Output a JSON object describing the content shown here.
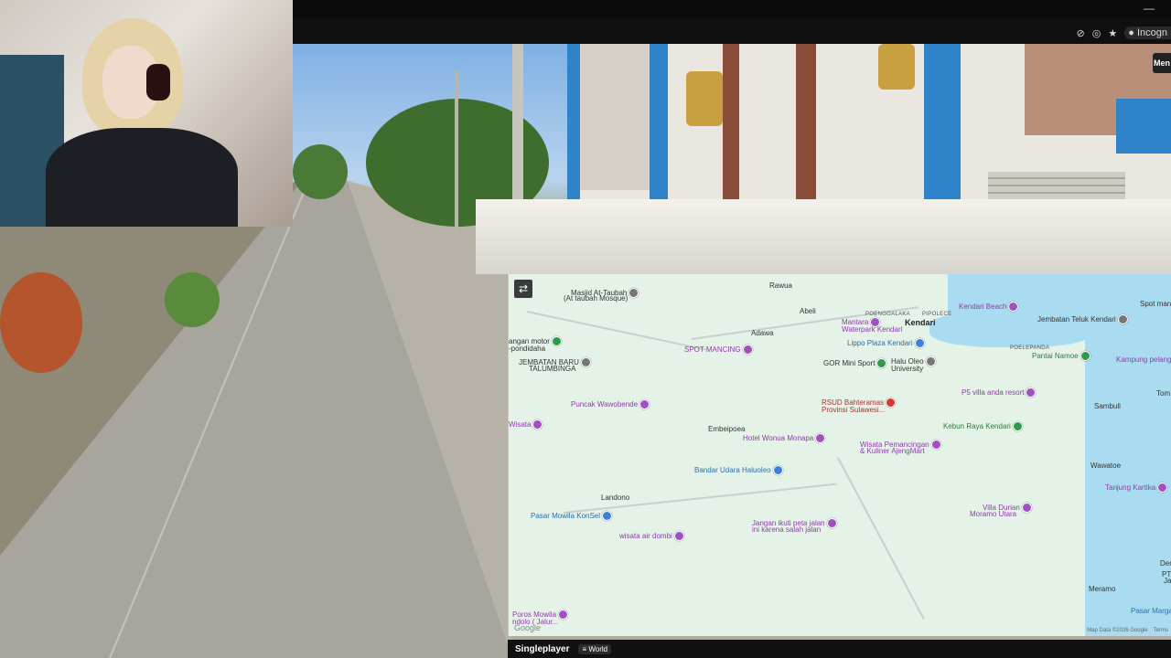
{
  "browser": {
    "minimize_glyph": "—",
    "incognito_label": "Incogn"
  },
  "menu_button": {
    "label": "Men"
  },
  "map": {
    "toggle_glyph": "⇄",
    "google": "Google",
    "footer": [
      "Map Data ©2026 Google",
      "Terms"
    ],
    "places": [
      {
        "label": "Masjid At-Taubah",
        "cls": "dark",
        "pin": "gray"
      },
      {
        "label": "(At taubah Mosque)",
        "cls": "dark",
        "pin": null
      },
      {
        "label": "Rawua",
        "cls": "town",
        "pin": null
      },
      {
        "label": "Abeli",
        "cls": "town",
        "pin": null
      },
      {
        "label": "POENGGALAKA",
        "cls": "small",
        "pin": null
      },
      {
        "label": "PIPOLECE",
        "cls": "small",
        "pin": null
      },
      {
        "label": "Kendari Beach",
        "cls": "purple",
        "pin": "purple"
      },
      {
        "label": "Mantara",
        "cls": "purple",
        "pin": "purple"
      },
      {
        "label": "Waterpark Kendari",
        "cls": "purple",
        "pin": null
      },
      {
        "label": "Kendari",
        "cls": "city",
        "pin": null
      },
      {
        "label": "Jembatan Teluk Kendari",
        "cls": "dark",
        "pin": "gray"
      },
      {
        "label": "Spot mancin",
        "cls": "dark",
        "pin": null
      },
      {
        "label": "angan motor",
        "cls": "dark",
        "pin": "green"
      },
      {
        "label": "-pondidaha",
        "cls": "dark",
        "pin": null
      },
      {
        "label": "Adawa",
        "cls": "town",
        "pin": null
      },
      {
        "label": "Lippo Plaza Kendari",
        "cls": "blue",
        "pin": "blue"
      },
      {
        "label": "POELEPANDA",
        "cls": "small",
        "pin": null
      },
      {
        "label": "Pantai Namoe",
        "cls": "green",
        "pin": "green"
      },
      {
        "label": "Kampung pelang",
        "cls": "purple",
        "pin": "purple"
      },
      {
        "label": "SPOT MANCING",
        "cls": "purple",
        "pin": "purple"
      },
      {
        "label": "JEMBATAN BARU",
        "cls": "dark",
        "pin": "gray"
      },
      {
        "label": "TALUMBINGA",
        "cls": "dark",
        "pin": null
      },
      {
        "label": "GOR Mini Sport",
        "cls": "dark",
        "pin": "green"
      },
      {
        "label": "Halu Oleo",
        "cls": "dark",
        "pin": "gray"
      },
      {
        "label": "University",
        "cls": "dark",
        "pin": null
      },
      {
        "label": "P5 villa anda resort",
        "cls": "purple",
        "pin": "purple"
      },
      {
        "label": "Tom",
        "cls": "dark",
        "pin": null
      },
      {
        "label": "Puncak Wawobende",
        "cls": "purple",
        "pin": "purple"
      },
      {
        "label": "RSUD Bahteramas",
        "cls": "red",
        "pin": "red"
      },
      {
        "label": "Provinsi Sulawesi...",
        "cls": "red",
        "pin": null
      },
      {
        "label": "Sambuli",
        "cls": "town",
        "pin": null
      },
      {
        "label": "Wisata",
        "cls": "purple",
        "pin": "purple"
      },
      {
        "label": "Embeipoea",
        "cls": "town",
        "pin": null
      },
      {
        "label": "Kebun Raya Kendari",
        "cls": "green",
        "pin": "green"
      },
      {
        "label": "Hotel Wonua Monapa",
        "cls": "purple",
        "pin": "purple"
      },
      {
        "label": "Wisata Pemancingan",
        "cls": "purple",
        "pin": "purple"
      },
      {
        "label": "& Kuliner AjengMart",
        "cls": "purple",
        "pin": null
      },
      {
        "label": "Wawatoe",
        "cls": "town",
        "pin": null
      },
      {
        "label": "Bandar Udara Haluoleo",
        "cls": "blue",
        "pin": "blue"
      },
      {
        "label": "Tanjung Kartika",
        "cls": "purple",
        "pin": "purple"
      },
      {
        "label": "Landono",
        "cls": "town",
        "pin": null
      },
      {
        "label": "Villa Durian",
        "cls": "purple",
        "pin": "purple"
      },
      {
        "label": "Moramo Utara",
        "cls": "purple",
        "pin": null
      },
      {
        "label": "Pasar Mowila KonSel",
        "cls": "blue",
        "pin": "blue"
      },
      {
        "label": "Jangan ikuti peta jalan",
        "cls": "purple",
        "pin": "purple"
      },
      {
        "label": "ini karena salah jalan",
        "cls": "purple",
        "pin": null
      },
      {
        "label": "wisata air dombi",
        "cls": "purple",
        "pin": "purple"
      },
      {
        "label": "Derman",
        "cls": "dark",
        "pin": null
      },
      {
        "label": "PT",
        "cls": "dark",
        "pin": null
      },
      {
        "label": "Jaya",
        "cls": "dark",
        "pin": null
      },
      {
        "label": "Meramo",
        "cls": "town",
        "pin": null
      },
      {
        "label": "Pasar Margac",
        "cls": "blue",
        "pin": "blue"
      },
      {
        "label": "Poros Mowila",
        "cls": "purple",
        "pin": "purple"
      },
      {
        "label": "ndolo ( Jalur...",
        "cls": "purple",
        "pin": null
      }
    ]
  },
  "game": {
    "mode_label": "Singleplayer",
    "world_label": "World"
  }
}
